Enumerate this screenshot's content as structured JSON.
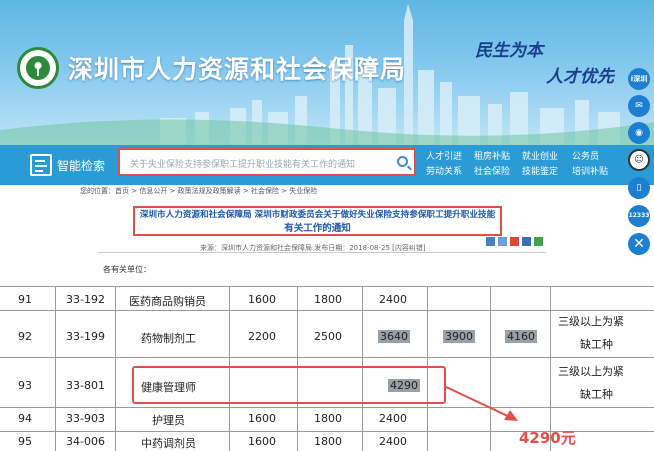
{
  "site": {
    "title": "深圳市人力资源和社会保障局",
    "slogan_1": "民生为本",
    "slogan_2": "人才优先"
  },
  "search": {
    "label": "智能检索",
    "placeholder": "关于失业保险支持参保职工提升职业技能有关工作的通知"
  },
  "quick_links": [
    [
      "人才引进",
      "劳动关系"
    ],
    [
      "租房补贴",
      "社会保险"
    ],
    [
      "就业创业",
      "技能鉴定"
    ],
    [
      "公务员",
      "培训补贴"
    ]
  ],
  "toolbar": {
    "ishenzhen": "i深圳",
    "hotline": "12333"
  },
  "article": {
    "breadcrumb": "您的位置：首页 > 信息公开 > 政策法规及政策解读 > 社会保险 > 失业保险",
    "title_line1": "深圳市人力资源和社会保障局 深圳市财政委员会关于做好失业保险支持参保职工提升职业技能",
    "title_line2": "有关工作的通知",
    "meta": "来源：深圳市人力资源和社会保障局   发布日期：2018-08-25   [内容纠错]",
    "addressee": "各有关单位："
  },
  "table": {
    "rows": [
      {
        "no": "91",
        "code": "33-192",
        "name": "医药商品购销员",
        "c1": "1600",
        "c2": "1800",
        "c3": "2400",
        "c4": "",
        "c5": "",
        "note": ""
      },
      {
        "no": "92",
        "code": "33-199",
        "name": "药物制剂工",
        "c1": "2200",
        "c2": "2500",
        "c3": "3640",
        "c4": "3900",
        "c5": "4160",
        "note_1": "三级以上为紧",
        "note_2": "缺工种"
      },
      {
        "no": "93",
        "code": "33-801",
        "name": "健康管理师",
        "c1": "",
        "c2": "",
        "c3": "4290",
        "c4": "",
        "c5": "",
        "note_1": "三级以上为紧",
        "note_2": "缺工种"
      },
      {
        "no": "94",
        "code": "33-903",
        "name": "护理员",
        "c1": "1600",
        "c2": "1800",
        "c3": "2400",
        "c4": "",
        "c5": ""
      },
      {
        "no": "95",
        "code": "34-006",
        "name": "中药调剂员",
        "c1": "1600",
        "c2": "1800",
        "c3": "2400",
        "c4": "",
        "c5": ""
      }
    ],
    "callout": "4290元"
  },
  "colors": {
    "accent_red": "#e0504b",
    "bar_blue": "#2a9bd4",
    "title_blue": "#1f5aa8"
  }
}
